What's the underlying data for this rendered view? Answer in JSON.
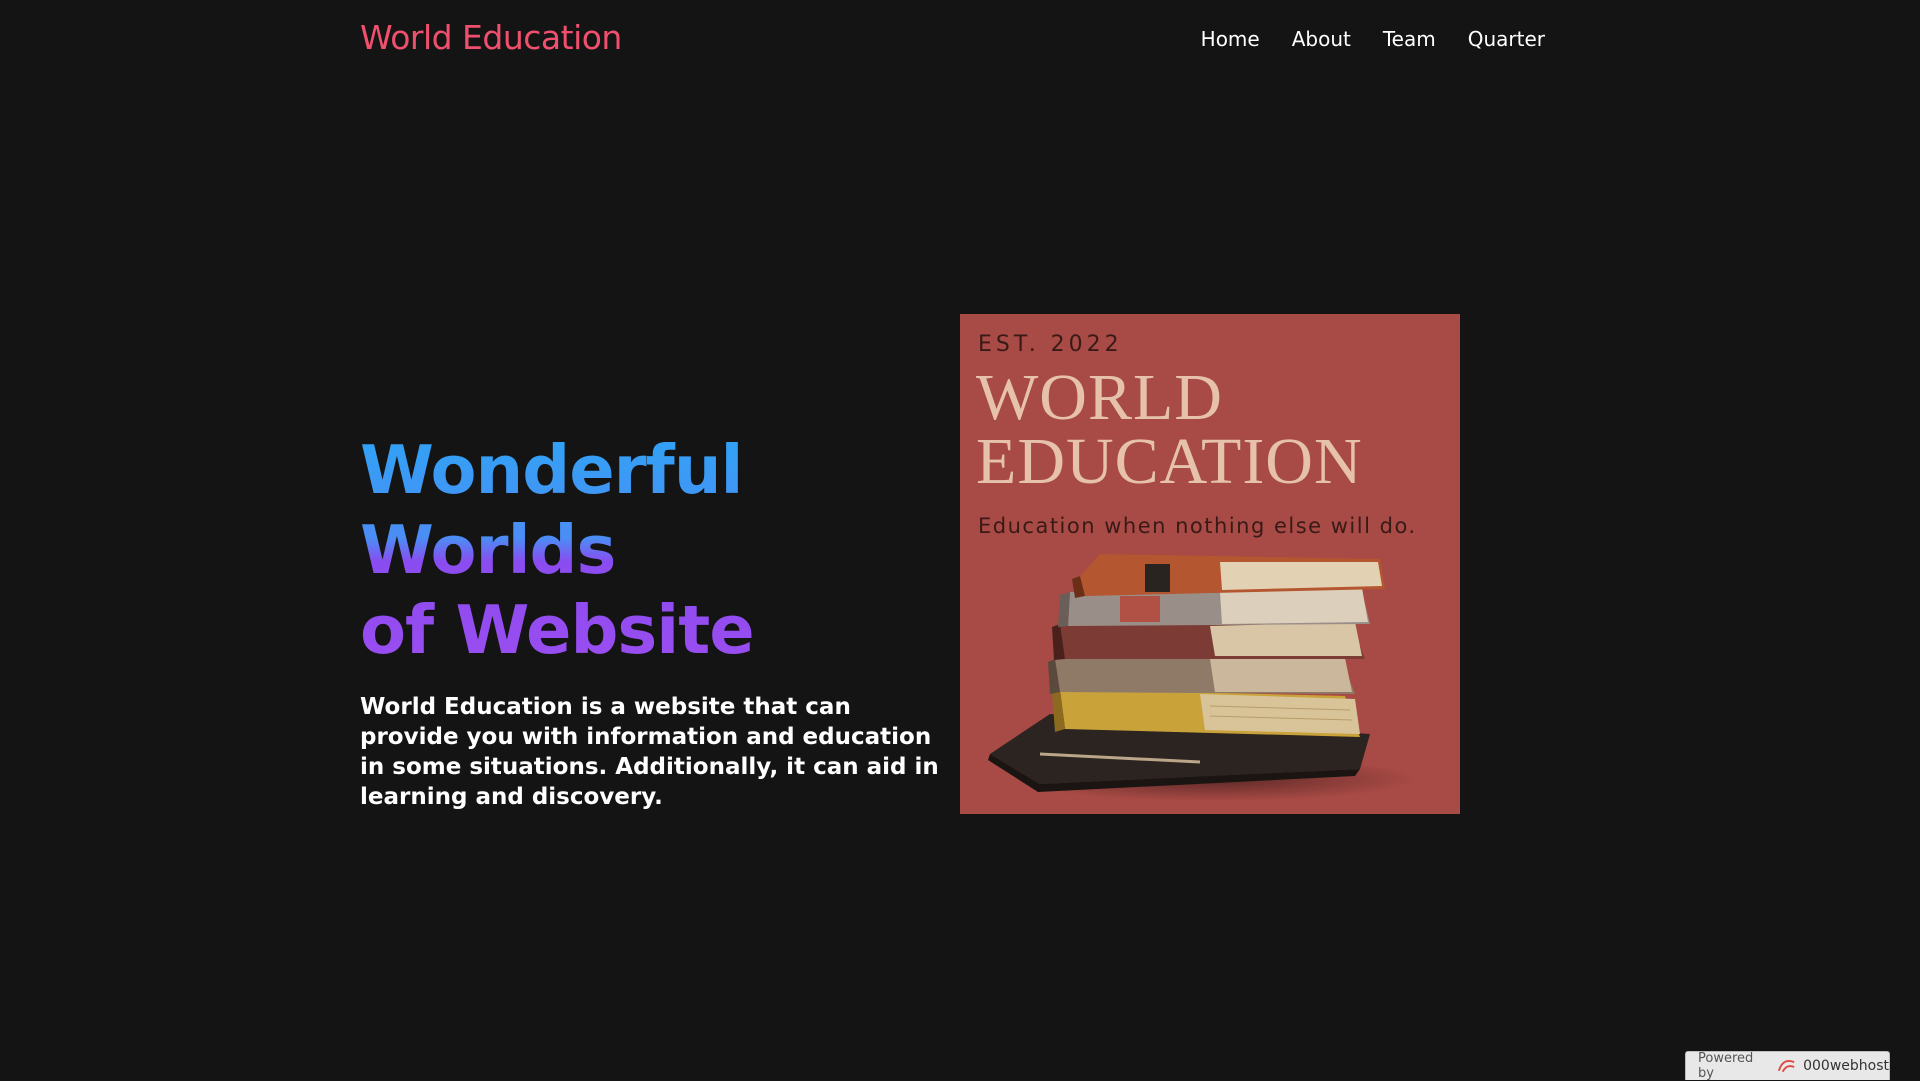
{
  "header": {
    "brand": "World Education",
    "nav": [
      {
        "label": "Home"
      },
      {
        "label": "About"
      },
      {
        "label": "Team"
      },
      {
        "label": "Quarter"
      }
    ]
  },
  "hero": {
    "title_line1": "Wonderful Worlds",
    "title_line2": "of Website",
    "description": "World Education is a website that can provide you with information and education in some situations. Additionally, it can aid in learning and discovery."
  },
  "poster": {
    "est": "EST. 2022",
    "title_line1": "WORLD",
    "title_line2": "EDUCATION",
    "tagline": "Education when nothing else will do.",
    "image_icon": "books-stack-icon"
  },
  "footer_badge": {
    "powered_by": "Powered by",
    "brand": "000webhost",
    "icon": "000webhost-logo-icon"
  },
  "colors": {
    "background": "#141414",
    "brand": "#f0506e",
    "poster_bg": "#a84a45",
    "gradient_top": "#2fa4f5",
    "gradient_bottom": "#9b4df0"
  }
}
